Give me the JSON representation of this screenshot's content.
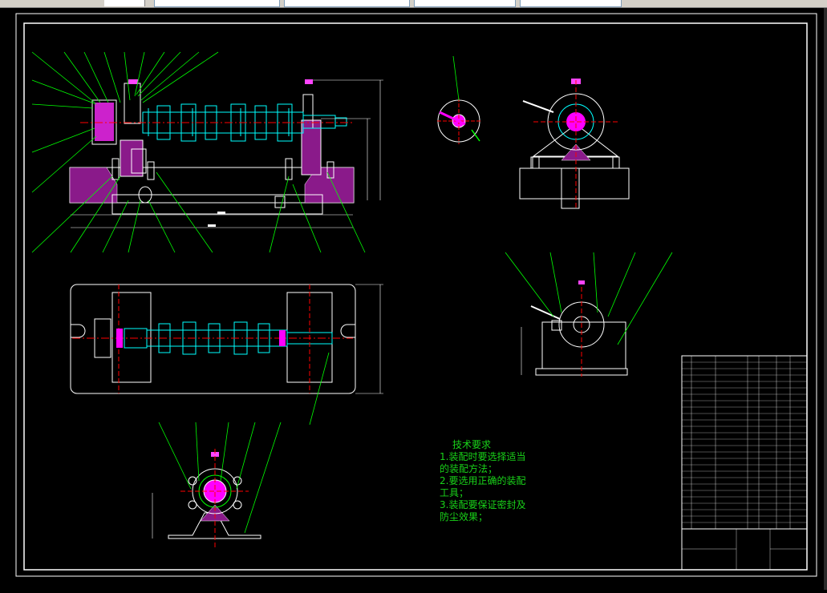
{
  "toolbar": {
    "icons": [
      "layer-icon",
      "properties-icon"
    ]
  },
  "drawing": {
    "tech_requirements": {
      "title": "技术要求",
      "lines": [
        "1.装配时要选择适当",
        "的装配方法；",
        "2.要选用正确的装配",
        "工具；",
        "3.装配要保证密封及",
        "防尘效果；"
      ]
    },
    "colors": {
      "background": "#000000",
      "frame": "#ffffff",
      "leader": "#00ff00",
      "center": "#ff0000",
      "part": "#00ffff",
      "section": "#ff00ff",
      "text": "#19d219"
    }
  }
}
